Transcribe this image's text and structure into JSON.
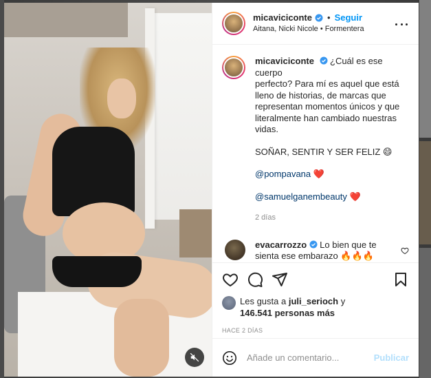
{
  "post": {
    "author": "micaviciconte",
    "follow_label": "Seguir",
    "location": "Aitana, Nicki Nicole • Formentera",
    "caption_lines": [
      "¿Cuál es ese cuerpo",
      "perfecto? Para mí es aquel que está",
      "lleno de historias, de marcas que",
      "representan momentos únicos y que",
      "literalmente han cambiado nuestras",
      "vidas."
    ],
    "caption_shout": "SOÑAR, SENTIR Y SER FELIZ 😄",
    "mention_1": "@pompavana",
    "mention_1_emoji": "❤️",
    "mention_2": "@samuelganembeauty",
    "mention_2_emoji": "❤️",
    "caption_time": "2 días"
  },
  "comment": {
    "author": "evacarrozzo",
    "text_line1": "Lo bien que te",
    "text_line2": "sienta ese embarazo 🔥🔥🔥"
  },
  "likes": {
    "prefix": "Les gusta a",
    "user": "juli_serioch",
    "joiner": "y",
    "count": "146.541 personas más"
  },
  "date_label": "HACE 2 DÍAS",
  "composer": {
    "placeholder": "Añade un comentario...",
    "publish_label": "Publicar"
  },
  "colors": {
    "link_blue": "#0095f6",
    "publish_disabled": "#b2dffc",
    "muted_text": "#8e8e8e"
  }
}
